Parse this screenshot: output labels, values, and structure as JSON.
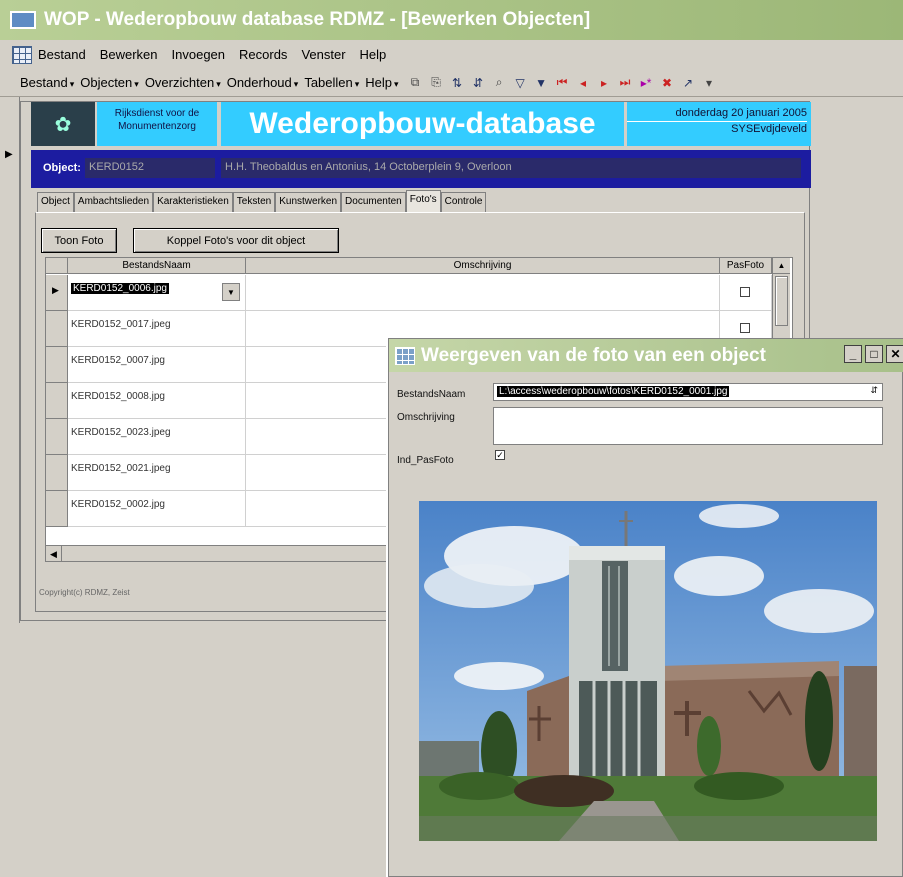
{
  "window": {
    "title": "WOP - Wederopbouw database RDMZ - [Bewerken Objecten]"
  },
  "menubar": {
    "items": [
      "Bestand",
      "Bewerken",
      "Invoegen",
      "Records",
      "Venster",
      "Help"
    ]
  },
  "toolbar": {
    "menus": [
      "Bestand",
      "Objecten",
      "Overzichten",
      "Onderhoud",
      "Tabellen",
      "Help"
    ]
  },
  "header": {
    "org_line1": "Rijksdienst voor de",
    "org_line2": "Monumentenzorg",
    "db_title": "Wederopbouw-database",
    "date": "donderdag 20 januari 2005",
    "user": "SYSEvdjdeveld"
  },
  "object": {
    "label": "Object:",
    "code": "KERD0152",
    "description": "H.H. Theobaldus en Antonius, 14 Octoberplein 9, Overloon"
  },
  "tabs": [
    "Object",
    "Ambachtslieden",
    "Karakteristieken",
    "Teksten",
    "Kunstwerken",
    "Documenten",
    "Foto's",
    "Controle"
  ],
  "active_tab": "Foto's",
  "buttons": {
    "toon_foto": "Toon Foto",
    "koppel": "Koppel Foto's voor dit object"
  },
  "grid": {
    "headers": [
      "BestandsNaam",
      "Omschrijving",
      "PasFoto"
    ],
    "rows": [
      {
        "name": "KERD0152_0006.jpg"
      },
      {
        "name": "KERD0152_0017.jpeg"
      },
      {
        "name": "KERD0152_0007.jpg"
      },
      {
        "name": "KERD0152_0008.jpg"
      },
      {
        "name": "KERD0152_0023.jpeg"
      },
      {
        "name": "KERD0152_0021.jpeg"
      },
      {
        "name": "KERD0152_0002.jpg"
      }
    ]
  },
  "copyright": "Copyright(c) RDMZ, Zeist",
  "popup": {
    "title": "Weergeven van de foto van een object",
    "label_filename": "BestandsNaam",
    "value_filename": "L:\\access\\wederopbouw\\fotos\\KERD0152_0001.jpg",
    "label_description": "Omschrijving",
    "label_pasfoto": "Ind_PasFoto"
  }
}
